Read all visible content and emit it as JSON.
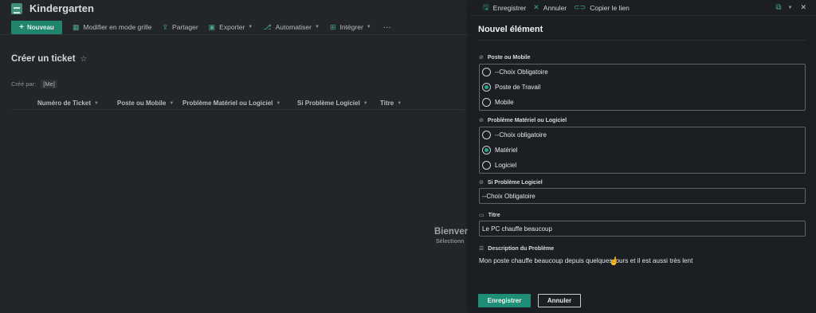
{
  "site": {
    "title": "Kindergarten"
  },
  "commandbar": {
    "new_label": "Nouveau",
    "items": [
      {
        "label": "Modifier en mode grille"
      },
      {
        "label": "Partager"
      },
      {
        "label": "Exporter"
      },
      {
        "label": "Automatiser"
      },
      {
        "label": "Intégrer"
      }
    ],
    "more": "···"
  },
  "view": {
    "title": "Créer un ticket",
    "filter_label": "Créé par:",
    "filter_value": "[Me]",
    "columns": [
      "Numéro de Ticket",
      "Poste ou Mobile",
      "Problème Matériel ou Logiciel",
      "Si Problème Logiciel",
      "Titre"
    ],
    "empty_title": "Bienver",
    "empty_subtitle": "Sélectionn"
  },
  "panel": {
    "toolbar": {
      "save": "Enregistrer",
      "cancel": "Annuler",
      "copy_link": "Copier le lien"
    },
    "title": "Nouvel élément",
    "fields": {
      "poste": {
        "label": "Poste ou Mobile",
        "options": [
          "--Choix Obligatoire",
          "Poste de Travail",
          "Mobile"
        ],
        "selected": "Poste de Travail"
      },
      "probleme": {
        "label": "Problème Matériel ou Logiciel",
        "options": [
          "--Choix obligatoire",
          "Matériel",
          "Logiciel"
        ],
        "selected": "Matériel"
      },
      "logiciel": {
        "label": "Si Problème Logiciel",
        "value": "--Choix Obligatoire"
      },
      "titre": {
        "label": "Titre",
        "value": "Le PC chauffe beaucoup"
      },
      "description": {
        "label": "Description du Problème",
        "value": "Mon poste chauffe beaucoup depuis quelques jours et il est aussi très lent"
      }
    },
    "footer": {
      "save": "Enregistrer",
      "cancel": "Annuler"
    }
  },
  "colors": {
    "accent": "#21856e",
    "panel_bg": "#1b1f23",
    "app_bg": "#232629"
  }
}
